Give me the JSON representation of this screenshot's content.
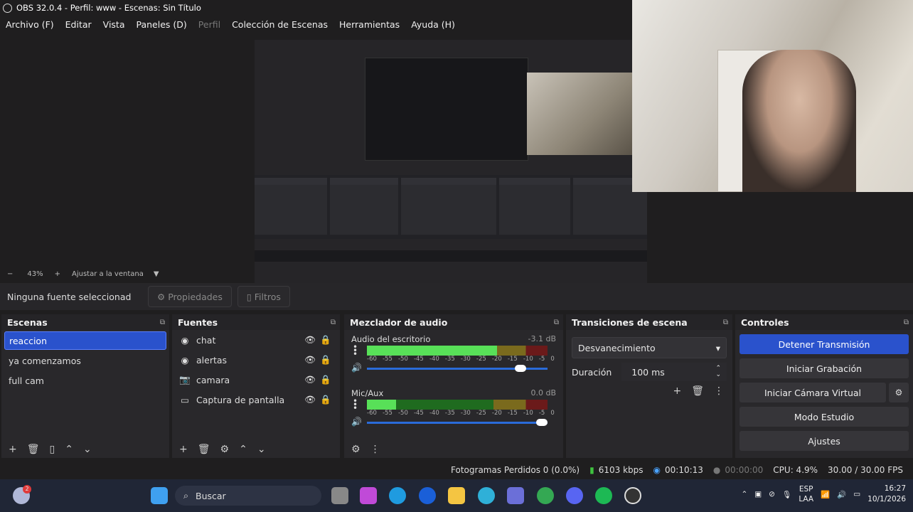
{
  "window": {
    "title": "OBS 32.0.4 - Perfil: www - Escenas: Sin Título"
  },
  "menu": [
    "Archivo (F)",
    "Editar",
    "Vista",
    "Paneles (D)",
    "Perfil",
    "Colección de Escenas",
    "Herramientas",
    "Ayuda (H)"
  ],
  "zoom": {
    "minus": "−",
    "value": "43%",
    "plus": "+",
    "fit": "Ajustar a la ventana"
  },
  "source_toolbar": {
    "status": "Ninguna fuente seleccionad",
    "properties": "Propiedades",
    "filters": "Filtros"
  },
  "scenes": {
    "title": "Escenas",
    "items": [
      "reaccion",
      "ya comenzamos",
      "full cam"
    ],
    "selected": 0
  },
  "sources": {
    "title": "Fuentes",
    "items": [
      {
        "label": "chat",
        "icon": "browser-icon"
      },
      {
        "label": "alertas",
        "icon": "browser-icon"
      },
      {
        "label": "camara",
        "icon": "camera-icon"
      },
      {
        "label": "Captura de pantalla",
        "icon": "monitor-icon"
      }
    ]
  },
  "mixer": {
    "title": "Mezclador de audio",
    "channels": [
      {
        "name": "Audio del escritorio",
        "db": "-3.1 dB",
        "level": 0.72,
        "volume": 0.88
      },
      {
        "name": "Mic/Aux",
        "db": "0.0 dB",
        "level": 0.16,
        "volume": 1.0
      }
    ],
    "ticks": [
      "-60",
      "-55",
      "-50",
      "-45",
      "-40",
      "-35",
      "-30",
      "-25",
      "-20",
      "-15",
      "-10",
      "-5",
      "0"
    ]
  },
  "transitions": {
    "title": "Transiciones de escena",
    "selected": "Desvanecimiento",
    "duration_label": "Duración",
    "duration_value": "100 ms"
  },
  "controls": {
    "title": "Controles",
    "stream": "Detener Transmisión",
    "record": "Iniciar Grabación",
    "virtualcam": "Iniciar Cámara Virtual",
    "studio": "Modo Estudio",
    "settings": "Ajustes"
  },
  "status": {
    "dropped": "Fotogramas Perdidos 0 (0.0%)",
    "bitrate": "6103 kbps",
    "stream_time": "00:10:13",
    "rec_time": "00:00:00",
    "cpu": "CPU: 4.9%",
    "fps": "30.00 / 30.00 FPS"
  },
  "taskbar": {
    "search": "Buscar",
    "lang1": "ESP",
    "lang2": "LAA",
    "time": "16:27",
    "date": "10/1/2026",
    "badge": "2"
  },
  "colors": {
    "accent": "#2a52cc",
    "panel": "#29282b",
    "bg": "#1f1e1f"
  }
}
